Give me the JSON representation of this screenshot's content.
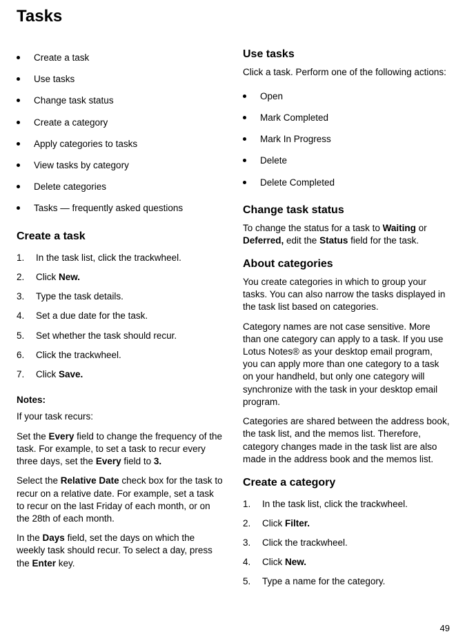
{
  "page_title": "Tasks",
  "page_number": "49",
  "left": {
    "toc": [
      "Create a task",
      "Use tasks",
      "Change task status",
      "Create a category",
      "Apply categories to tasks",
      "View tasks by category",
      "Delete categories",
      "Tasks — frequently asked questions"
    ],
    "create_task_heading": "Create a task",
    "create_task_steps": [
      {
        "n": "1.",
        "pre": "In the task list, click the trackwheel.",
        "b": "",
        "post": ""
      },
      {
        "n": "2.",
        "pre": "Click ",
        "b": "New.",
        "post": ""
      },
      {
        "n": "3.",
        "pre": "Type the task details.",
        "b": "",
        "post": ""
      },
      {
        "n": "4.",
        "pre": "Set a due date for the task.",
        "b": "",
        "post": ""
      },
      {
        "n": "5.",
        "pre": "Set whether the task should recur.",
        "b": "",
        "post": ""
      },
      {
        "n": "6.",
        "pre": "Click the trackwheel.",
        "b": "",
        "post": ""
      },
      {
        "n": "7.",
        "pre": "Click ",
        "b": "Save.",
        "post": ""
      }
    ],
    "notes_heading": "Notes:",
    "notes_intro": "If your task recurs:",
    "note1": {
      "a": "Set the ",
      "b": "Every",
      "c": " field to change the frequency of the task. For example, to set a task to recur every three days, set the ",
      "d": "Every",
      "e": " field to ",
      "f": "3."
    },
    "note2": {
      "a": "Select the ",
      "b": "Relative Date",
      "c": " check box for the task to recur on a relative date. For example, set a task to recur on the last Friday of each month, or on the 28th of each month."
    },
    "note3": {
      "a": "In the ",
      "b": "Days",
      "c": " field, set the days on which the weekly task should recur. To select a day, press the ",
      "d": "Enter",
      "e": " key."
    }
  },
  "right": {
    "use_tasks_heading": "Use tasks",
    "use_tasks_intro": "Click a task. Perform one of the following actions:",
    "actions": [
      "Open",
      "Mark Completed",
      "Mark In Progress",
      "Delete",
      "Delete Completed"
    ],
    "change_status_heading": "Change task status",
    "change_status": {
      "a": "To change the status for a task to ",
      "b": "Waiting",
      "c": " or ",
      "d": "Deferred,",
      "e": " edit the ",
      "f": "Status",
      "g": " field for the task."
    },
    "about_cat_heading": "About categories",
    "about_cat_p1": "You create categories in which to group your tasks. You can also narrow the tasks displayed in the task list based on categories.",
    "about_cat_p2": "Category names are not case sensitive. More than one category can apply to a task. If you use Lotus Notes® as your desktop email program, you can apply more than one category to a task on your handheld, but only one category will synchronize with the task in your desktop email program.",
    "about_cat_p3": "Categories are shared between the address book, the task list, and the memos list. Therefore, category changes made in the task list are also made in the address book and the memos list.",
    "create_cat_heading": "Create a category",
    "create_cat_steps": [
      {
        "n": "1.",
        "pre": "In the task list, click the trackwheel.",
        "b": "",
        "post": ""
      },
      {
        "n": "2.",
        "pre": "Click ",
        "b": "Filter.",
        "post": ""
      },
      {
        "n": "3.",
        "pre": "Click the trackwheel.",
        "b": "",
        "post": ""
      },
      {
        "n": "4.",
        "pre": "Click ",
        "b": "New.",
        "post": ""
      },
      {
        "n": "5.",
        "pre": "Type a name for the category.",
        "b": "",
        "post": ""
      }
    ]
  }
}
